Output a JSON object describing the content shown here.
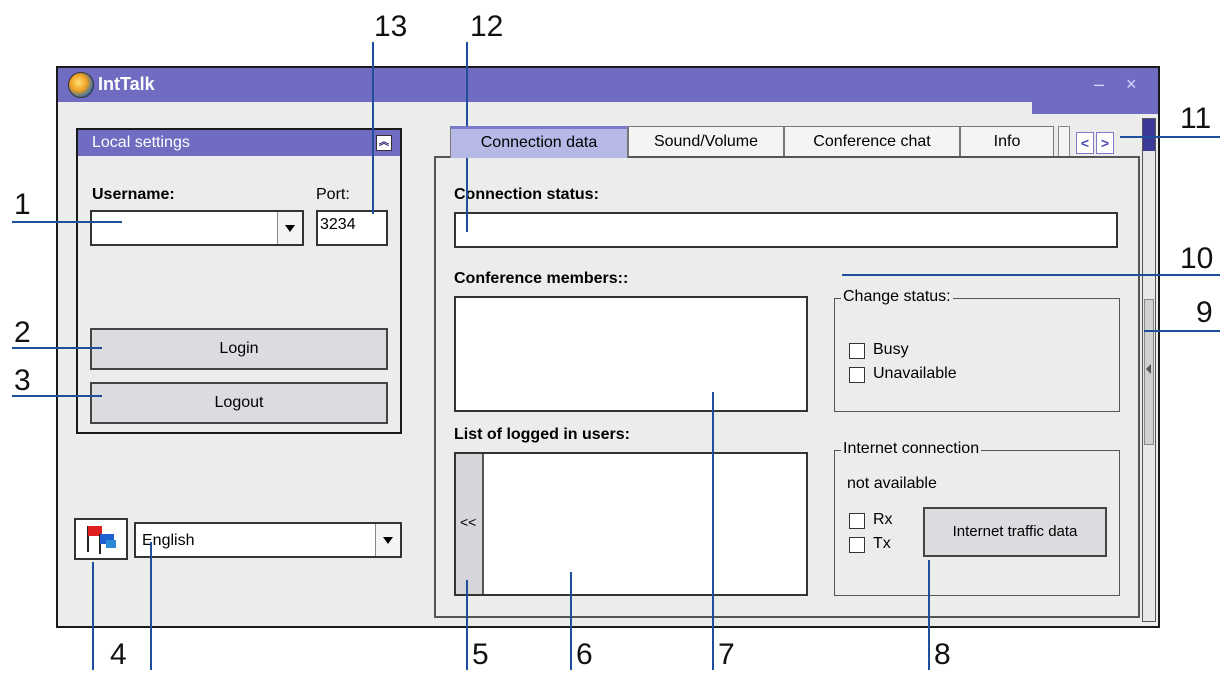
{
  "window": {
    "title": "IntTalk",
    "minimize": "–",
    "close": "×"
  },
  "local_settings": {
    "header": "Local settings",
    "username_label": "Username:",
    "port_label": "Port:",
    "username_value": "",
    "port_value": "3234",
    "login": "Login",
    "logout": "Logout"
  },
  "language": {
    "selected": "English"
  },
  "tabs": [
    {
      "label": "Connection data",
      "active": true
    },
    {
      "label": "Sound/Volume"
    },
    {
      "label": "Conference chat"
    },
    {
      "label": "Info"
    }
  ],
  "tab_nav": {
    "prev": "<",
    "next": ">"
  },
  "connection": {
    "status_label": "Connection status:",
    "status_value": "",
    "members_label": "Conference members::",
    "logged_label": "List of logged in users:",
    "collapse_toggle": "<<",
    "change_status": {
      "legend": "Change status:",
      "busy": "Busy",
      "unavailable": "Unavailable"
    },
    "internet": {
      "legend": "Internet connection",
      "status": "not available",
      "rx": "Rx",
      "tx": "Tx",
      "traffic_button": "Internet traffic data"
    }
  },
  "callouts": [
    "1",
    "2",
    "3",
    "4",
    "5",
    "6",
    "7",
    "8",
    "9",
    "10",
    "11",
    "12",
    "13"
  ],
  "colors": {
    "titlebar": "#6f6cc1",
    "callout_line": "#1f4e9a",
    "active_tab": "#b6b8e6"
  }
}
